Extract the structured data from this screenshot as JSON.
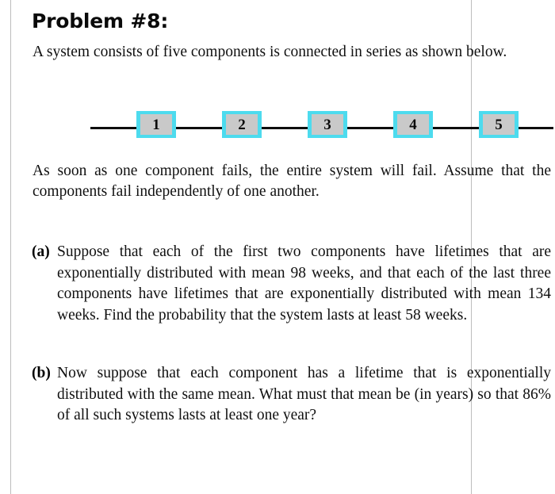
{
  "document": {
    "title": "Problem #8:",
    "intro_paragraph": "A system consists of five components is connected in series as shown below.",
    "assumption_paragraph": "As soon as one component fails, the entire system will fail. Assume that the components fail independently of one another."
  },
  "diagram": {
    "name": "series-system-diagram",
    "component_labels": [
      "1",
      "2",
      "3",
      "4",
      "5"
    ],
    "box_fill_color": "#c9c9c9",
    "box_border_color": "#4ddbee",
    "wire_color": "#0d0d0d"
  },
  "parts": [
    {
      "tag": "(a)",
      "text": "Suppose that each of the first two components have lifetimes that are exponentially distributed with mean 98 weeks, and that each of the last three components have lifetimes that are exponentially distributed with mean 134 weeks. Find the probability that the system lasts at least 58 weeks."
    },
    {
      "tag": "(b)",
      "text": "Now suppose that each component has a lifetime that is exponentially distributed with the same mean. What must that mean be (in years) so that 86% of all such systems lasts at least one year?"
    }
  ]
}
